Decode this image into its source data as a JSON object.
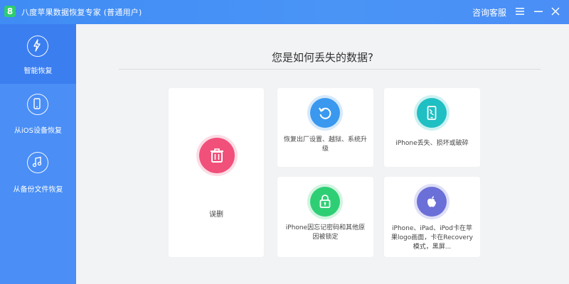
{
  "titlebar": {
    "app_title": "八度苹果数据恢复专家  (普通用户)",
    "support": "咨询客服",
    "menu_icon": "menu-icon",
    "min_icon": "minimize-icon",
    "close_icon": "close-icon"
  },
  "sidebar": {
    "items": [
      {
        "label": "智能恢复",
        "icon": "smart-recovery-icon",
        "active": true
      },
      {
        "label": "从iOS设备恢复",
        "icon": "phone-icon",
        "active": false
      },
      {
        "label": "从备份文件恢复",
        "icon": "music-note-icon",
        "active": false
      }
    ]
  },
  "main": {
    "title": "您是如何丢失的数据?",
    "cards": [
      {
        "label": "误删",
        "icon": "trash-icon",
        "color": "#f0507a"
      },
      {
        "label": "恢复出厂设置、越狱、系统升级",
        "icon": "restore-icon",
        "color": "#3a98ef"
      },
      {
        "label": "iPhone丢失、损坏或破碎",
        "icon": "broken-phone-icon",
        "color": "#1fbfc3"
      },
      {
        "label": "iPhone因忘记密码和其他原因被锁定",
        "icon": "lock-icon",
        "color": "#2ecf74"
      },
      {
        "label": "iPhone、iPad、iPod卡在苹果logo画面，卡在Recovery模式，黑屏...",
        "icon": "apple-logo-icon",
        "color": "#6b6fd8"
      }
    ]
  },
  "colors": {
    "accent": "#4a8ef6",
    "active": "#3b7ef0"
  }
}
